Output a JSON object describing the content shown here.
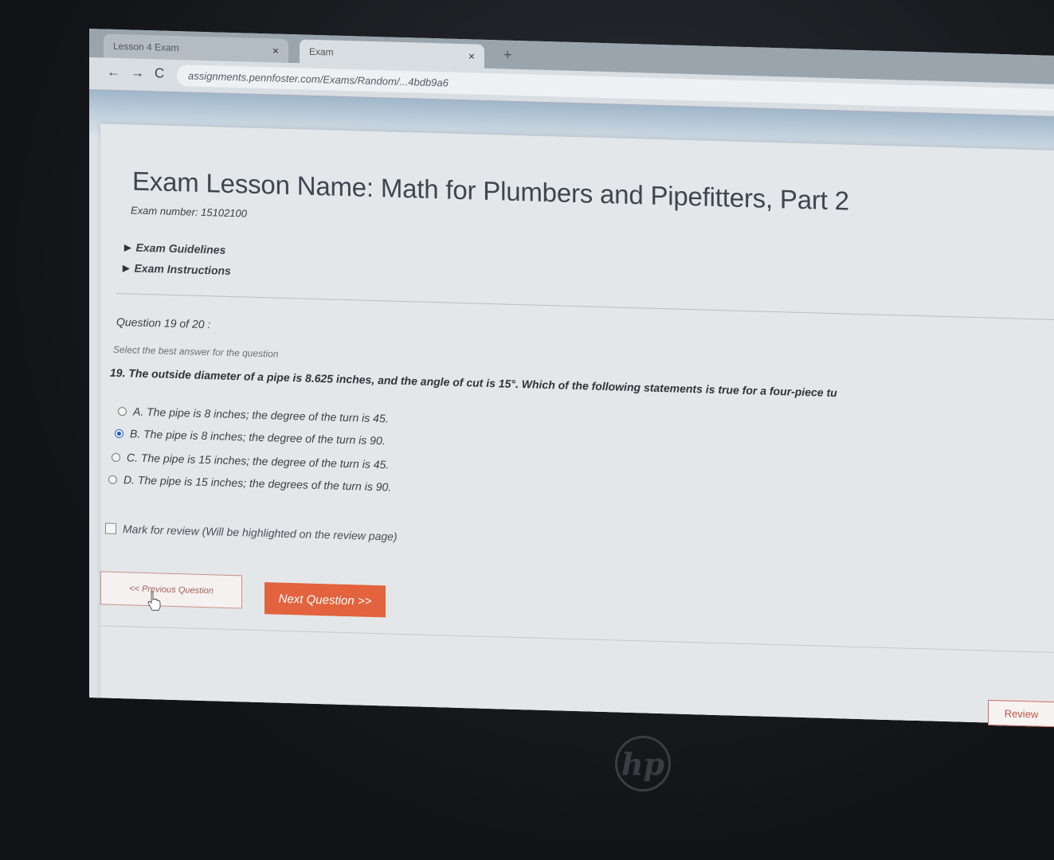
{
  "browser": {
    "tabs": [
      {
        "label": "Lesson 4 Exam",
        "close": "×"
      },
      {
        "label": "Exam",
        "close": "×"
      }
    ],
    "new_tab": "+",
    "nav": {
      "back": "←",
      "forward": "→",
      "reload": "C"
    },
    "url": "assignments.pennfoster.com/Exams/Random/...4bdb9a6"
  },
  "exam": {
    "title": "Exam Lesson Name: Math for Plumbers and Pipefitters, Part 2",
    "number": "Exam number: 15102100",
    "links": [
      "Exam Guidelines",
      "Exam Instructions"
    ],
    "question_count": "Question 19 of 20 :",
    "instruction": "Select the best answer for the question",
    "question": "19.  The outside diameter of a pipe is 8.625 inches, and the angle of cut is 15°. Which of the following statements is true for a four-piece tu",
    "options": [
      {
        "label": "A. The pipe is 8 inches; the degree of the turn is 45.",
        "selected": false
      },
      {
        "label": "B. The pipe is 8 inches; the degree of the turn is 90.",
        "selected": true
      },
      {
        "label": "C. The pipe is 15 inches; the degree of the turn is 45.",
        "selected": false
      },
      {
        "label": "D. The pipe is 15 inches; the degrees of the turn is 90.",
        "selected": false
      }
    ],
    "mark_review": "Mark for review (Will be highlighted on the review page)",
    "prev_button": "<< Previous Question",
    "next_button": "Next Question >>",
    "review_button": "Review"
  },
  "laptop": {
    "brand": "hp"
  },
  "colors": {
    "accent": "#e2633d",
    "radio_selected": "#1a57c8",
    "review": "#c35445"
  }
}
